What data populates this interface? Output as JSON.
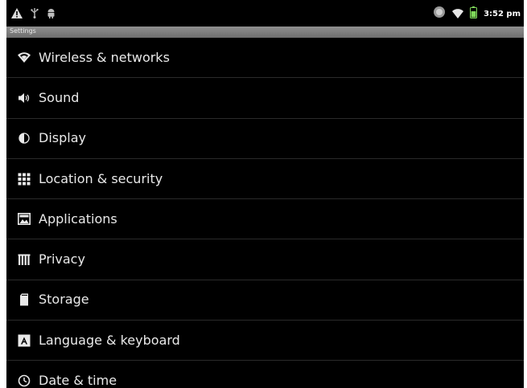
{
  "status_bar": {
    "icons_left": [
      "warning-icon",
      "usb-icon",
      "android-icon"
    ],
    "icons_right": [
      "sync-icon",
      "wifi-icon",
      "battery-icon"
    ],
    "time": "3:52 pm"
  },
  "title_bar": {
    "title": "Settings"
  },
  "settings_list": {
    "items": [
      {
        "icon": "wifi-icon",
        "label": "Wireless & networks"
      },
      {
        "icon": "speaker-icon",
        "label": "Sound"
      },
      {
        "icon": "brightness-icon",
        "label": "Display"
      },
      {
        "icon": "grid-icon",
        "label": "Location & security"
      },
      {
        "icon": "applications-icon",
        "label": "Applications"
      },
      {
        "icon": "privacy-icon",
        "label": "Privacy"
      },
      {
        "icon": "sd-card-icon",
        "label": "Storage"
      },
      {
        "icon": "keyboard-icon",
        "label": "Language & keyboard"
      },
      {
        "icon": "clock-icon",
        "label": "Date & time"
      }
    ]
  },
  "colors": {
    "background": "#000000",
    "text": "#e9e9e9",
    "title_bar": "#7f7f7f",
    "divider": "#2a2a2a",
    "battery": "#7fd85a"
  }
}
